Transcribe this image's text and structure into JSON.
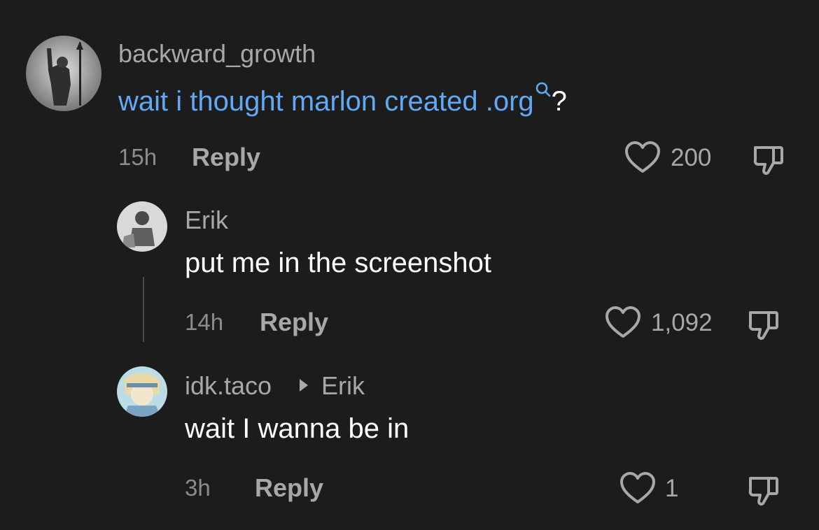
{
  "comments": [
    {
      "username": "backward_growth",
      "text": "wait i thought marlon created .org",
      "text_suffix": "?",
      "time": "15h",
      "reply_label": "Reply",
      "likes": "200"
    },
    {
      "username": "Erik",
      "text": "put me in the screenshot",
      "time": "14h",
      "reply_label": "Reply",
      "likes": "1,092"
    },
    {
      "username": "idk.taco",
      "reply_to": "Erik",
      "text": "wait I wanna be in",
      "time": "3h",
      "reply_label": "Reply",
      "likes": "1"
    }
  ],
  "colors": {
    "background": "#1c1c1c",
    "link": "#61a8f5",
    "muted": "#a8a8a8"
  },
  "icons": [
    "search-icon",
    "heart-icon",
    "dislike-icon",
    "reply-arrow-icon"
  ]
}
